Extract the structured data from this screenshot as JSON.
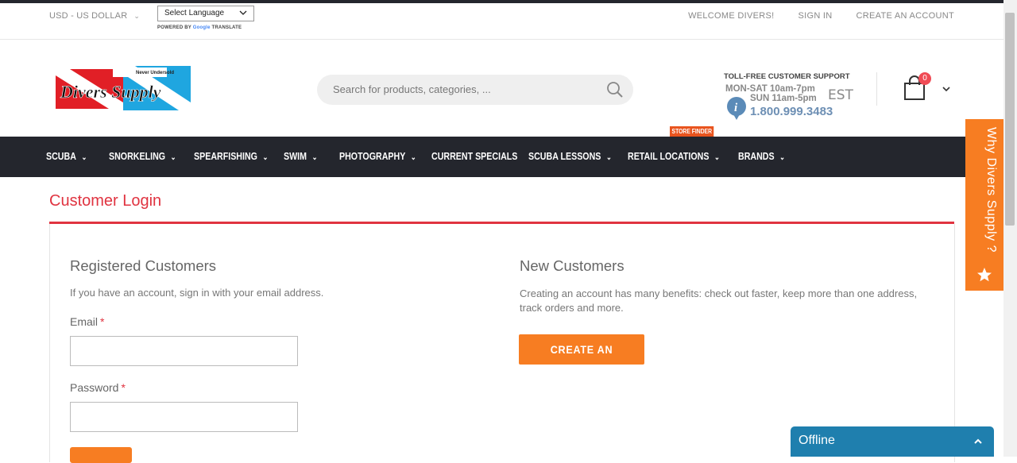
{
  "topbar": {
    "currency": "USD - US DOLLAR",
    "language_select": "Select Language",
    "powered_by": "POWERED BY",
    "google": "Google",
    "translate": "TRANSLATE",
    "links": [
      "WELCOME DIVERS!",
      "SIGN IN",
      "CREATE AN ACCOUNT"
    ]
  },
  "header": {
    "logo_text": "Divers Supply",
    "logo_tagline": "Never Undersold",
    "search_placeholder": "Search for products, categories, ...",
    "support": {
      "title": "TOLL-FREE CUSTOMER SUPPORT",
      "hours_weekday": "MON-SAT 10am-7pm",
      "hours_sunday": "SUN 11am-5pm",
      "timezone": "EST",
      "phone": "1.800.999.3483"
    },
    "cart_count": "0"
  },
  "nav": {
    "items": [
      {
        "label": "SCUBA",
        "dropdown": true
      },
      {
        "label": "SNORKELING",
        "dropdown": true
      },
      {
        "label": "SPEARFISHING",
        "dropdown": true
      },
      {
        "label": "SWIM",
        "dropdown": true
      },
      {
        "label": "PHOTOGRAPHY",
        "dropdown": true
      },
      {
        "label": "CURRENT SPECIALS",
        "dropdown": false
      },
      {
        "label": "SCUBA LESSONS",
        "dropdown": true
      },
      {
        "label": "RETAIL LOCATIONS",
        "dropdown": true
      },
      {
        "label": "BRANDS",
        "dropdown": true
      }
    ],
    "store_finder_badge": "STORE FINDER"
  },
  "page": {
    "title": "Customer Login",
    "registered": {
      "heading": "Registered Customers",
      "description": "If you have an account, sign in with your email address.",
      "email_label": "Email",
      "password_label": "Password",
      "required_mark": "*",
      "email_value": "",
      "password_value": ""
    },
    "new_customers": {
      "heading": "New Customers",
      "description": "Creating an account has many benefits: check out faster, keep more than one address, track orders and more.",
      "button": "CREATE AN ACCOUNT"
    }
  },
  "side_tab": {
    "label": "Why Divers Supply ?"
  },
  "chat": {
    "status": "Offline"
  },
  "colors": {
    "nav_bg": "#24262d",
    "accent_red": "#e03340",
    "accent_orange": "#f77d22",
    "chat_blue": "#1f7fae",
    "phone_blue": "#6d8fb4"
  }
}
